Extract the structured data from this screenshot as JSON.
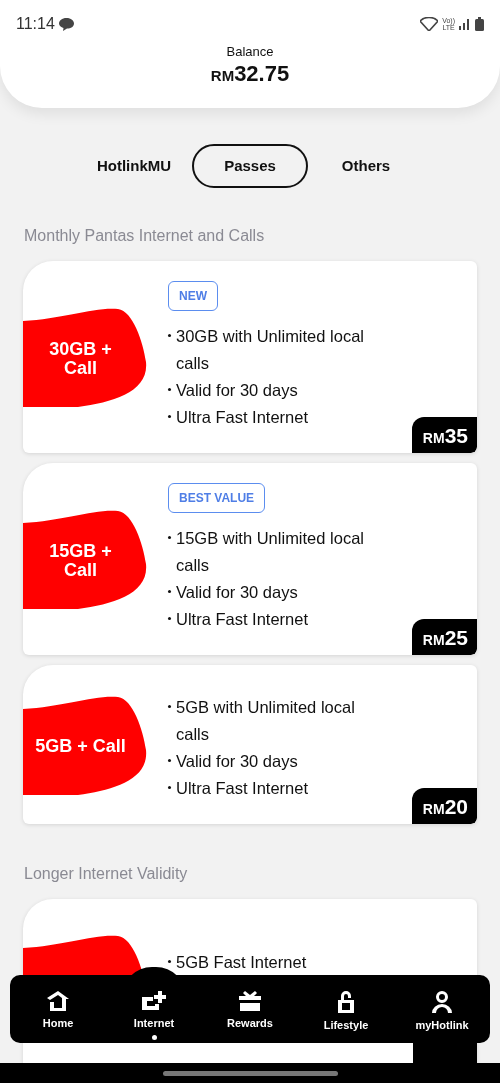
{
  "status_bar": {
    "time": "11:14",
    "volte_top": "Vo))",
    "volte_bottom": "LTE"
  },
  "balance": {
    "label": "Balance",
    "currency": "RM",
    "amount": "32.75"
  },
  "tabs": [
    {
      "label": "HotlinkMU",
      "selected": false
    },
    {
      "label": "Passes",
      "selected": true
    },
    {
      "label": "Others",
      "selected": false
    }
  ],
  "sections": [
    {
      "title": "Monthly Pantas Internet and Calls",
      "plans": [
        {
          "name": "30GB + Call",
          "badge": "NEW",
          "features": [
            "30GB with Unlimited local calls",
            "Valid for 30 days",
            "Ultra Fast Internet"
          ],
          "currency": "RM",
          "amount": "35"
        },
        {
          "name": "15GB + Call",
          "badge": "BEST VALUE",
          "features": [
            "15GB with Unlimited local calls",
            "Valid for 30 days",
            "Ultra Fast Internet"
          ],
          "currency": "RM",
          "amount": "25"
        },
        {
          "name": "5GB + Call",
          "features": [
            "5GB with Unlimited local calls",
            "Valid for 30 days",
            "Ultra Fast Internet"
          ],
          "currency": "RM",
          "amount": "20"
        }
      ]
    },
    {
      "title": "Longer Internet Validity",
      "plans": [
        {
          "features": [
            "5GB Fast Internet"
          ]
        }
      ]
    }
  ],
  "bottom_nav": [
    {
      "label": "Home",
      "selected": false
    },
    {
      "label": "Internet",
      "selected": true
    },
    {
      "label": "Rewards",
      "selected": false
    },
    {
      "label": "Lifestyle",
      "selected": false
    },
    {
      "label": "myHotlink",
      "selected": false
    }
  ]
}
